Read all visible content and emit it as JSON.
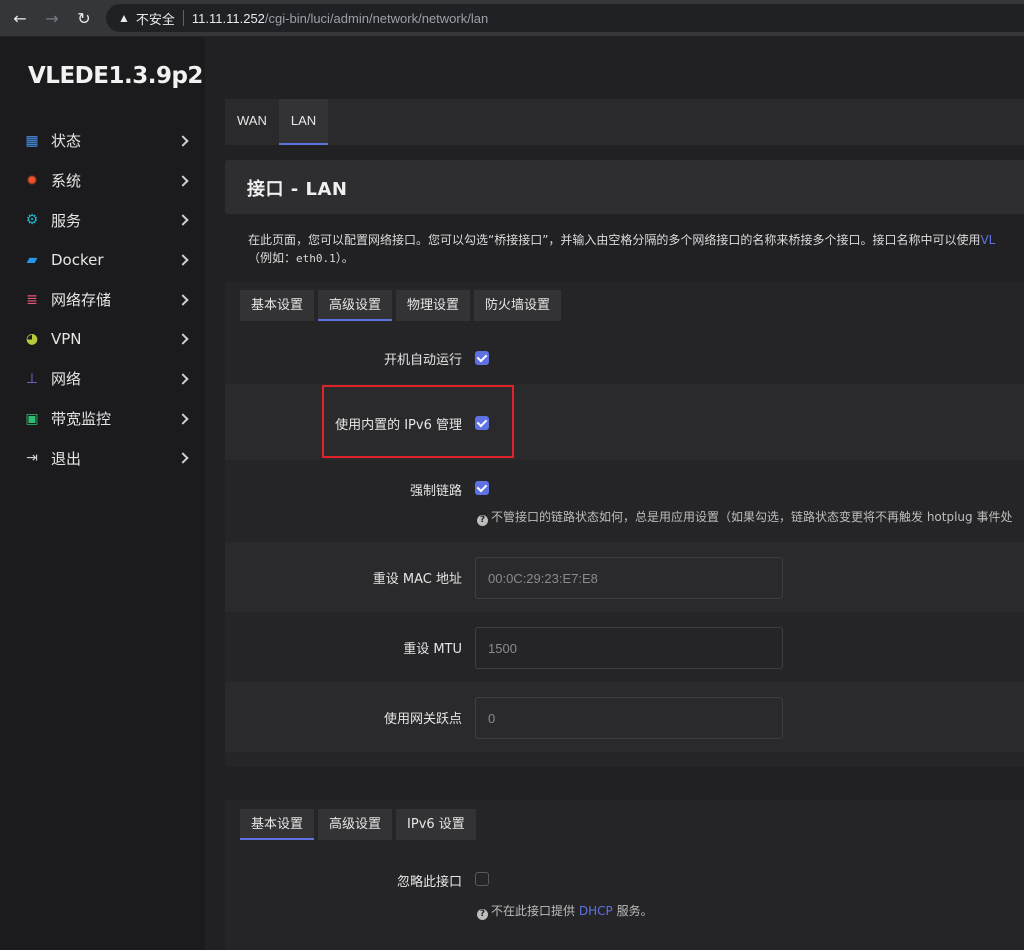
{
  "browser": {
    "back_icon": "←",
    "forward_icon": "→",
    "reload_icon": "↻",
    "warn_icon": "▲",
    "insecure_label": "不安全",
    "url_host": "11.11.11.252",
    "url_path": "/cgi-bin/luci/admin/network/network/lan"
  },
  "sidebar": {
    "brand": "VLEDE1.3.9p2",
    "items": [
      {
        "label": "状态",
        "icon": "dashboard-icon",
        "glyph": "▦",
        "color": "#4a8fe7"
      },
      {
        "label": "系统",
        "icon": "gear-icon",
        "glyph": "✹",
        "color": "#f0512b"
      },
      {
        "label": "服务",
        "icon": "services-icon",
        "glyph": "⚙",
        "color": "#27b5c9"
      },
      {
        "label": "Docker",
        "icon": "docker-icon",
        "glyph": "▰",
        "color": "#2496ed"
      },
      {
        "label": "网络存储",
        "icon": "storage-icon",
        "glyph": "≣",
        "color": "#e8567a"
      },
      {
        "label": "VPN",
        "icon": "vpn-globe-icon",
        "glyph": "◕",
        "color": "#b9c93a"
      },
      {
        "label": "网络",
        "icon": "network-icon",
        "glyph": "⊥",
        "color": "#7b6cd9"
      },
      {
        "label": "带宽监控",
        "icon": "monitor-icon",
        "glyph": "▣",
        "color": "#2fbf71"
      },
      {
        "label": "退出",
        "icon": "logout-icon",
        "glyph": "⇥",
        "color": "#d0d0d0"
      }
    ]
  },
  "main": {
    "top_tabs": [
      "WAN",
      "LAN"
    ],
    "active_top_tab": "LAN",
    "page_title": "接口 - LAN",
    "description_line1": "在此页面，您可以配置网络接口。您可以勾选“桥接接口”，并输入由空格分隔的多个网络接口的名称来桥接多个接口。接口名称中可以使用",
    "description_link": "VL",
    "description_line2_pre": "（例如：",
    "description_code": "eth0.1",
    "description_line2_post": "）。",
    "section1": {
      "tabs": [
        "基本设置",
        "高级设置",
        "物理设置",
        "防火墙设置"
      ],
      "active_tab": "高级设置",
      "autostart_label": "开机自动运行",
      "autostart_checked": true,
      "ipv6_label": "使用内置的 IPv6 管理",
      "ipv6_checked": true,
      "force_link_label": "强制链路",
      "force_link_checked": true,
      "force_link_hint": "不管接口的链路状态如何，总是用应用设置（如果勾选，链路状态变更将不再触发 hotplug 事件处",
      "mac_label": "重设 MAC 地址",
      "mac_placeholder": "00:0C:29:23:E7:E8",
      "mtu_label": "重设 MTU",
      "mtu_placeholder": "1500",
      "metric_label": "使用网关跃点",
      "metric_placeholder": "0"
    },
    "section2": {
      "tabs": [
        "基本设置",
        "高级设置",
        "IPv6 设置"
      ],
      "active_tab": "基本设置",
      "ignore_label": "忽略此接口",
      "ignore_checked": false,
      "ignore_hint_pre": "不在此接口提供",
      "ignore_hint_link": "DHCP",
      "ignore_hint_post": "服务。"
    },
    "accent_color": "#5e72e4",
    "highlight_color": "#e0232b"
  }
}
